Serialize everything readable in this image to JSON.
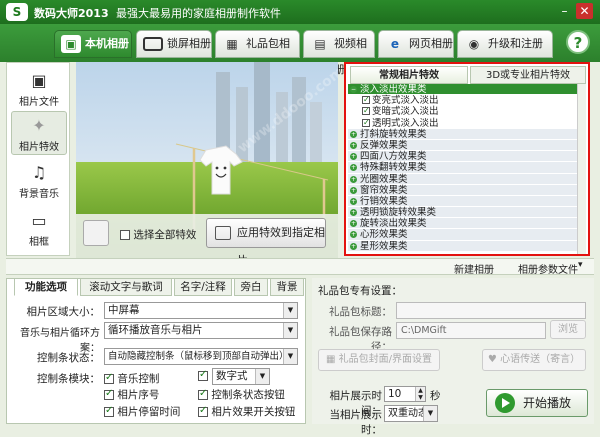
{
  "window": {
    "logo": "S",
    "app_name": "数码大师2013",
    "slogan": "最强大最易用的家庭相册制作软件"
  },
  "top_tabs": [
    {
      "label": "本机相册",
      "icon": "photo-album-icon"
    },
    {
      "label": "锁屏相册",
      "icon": "monitor-icon"
    },
    {
      "label": "礼品包相册",
      "icon": "gift-icon"
    },
    {
      "label": "视频相册",
      "icon": "film-icon"
    },
    {
      "label": "网页相册",
      "icon": "browser-icon"
    },
    {
      "label": "升级和注册",
      "icon": "upgrade-icon"
    }
  ],
  "help": {
    "label": "?"
  },
  "sidebar": {
    "items": [
      {
        "label": "相片文件",
        "icon": "camera-icon"
      },
      {
        "label": "相片特效",
        "icon": "sparkle-icon"
      },
      {
        "label": "背景音乐",
        "icon": "music-note-icon"
      },
      {
        "label": "相框",
        "icon": "frame-icon"
      }
    ]
  },
  "preview": {
    "select_all_label": "选择全部特效",
    "apply_label": "应用特效到指定相片"
  },
  "effects": {
    "tabs": [
      "常规相片特效",
      "3D或专业相片特效"
    ],
    "items": [
      {
        "label": "淡入淡出效果类",
        "type": "group",
        "selected": true
      },
      {
        "label": "变亮式淡入淡出",
        "type": "child",
        "checked": true
      },
      {
        "label": "变暗式淡入淡出",
        "type": "child",
        "checked": true
      },
      {
        "label": "透明式淡入淡出",
        "type": "child",
        "checked": true
      },
      {
        "label": "打斜旋转效果类",
        "type": "group"
      },
      {
        "label": "反弹效果类",
        "type": "group"
      },
      {
        "label": "四面八方效果类",
        "type": "group"
      },
      {
        "label": "特殊翻转效果类",
        "type": "group"
      },
      {
        "label": "光圈效果类",
        "type": "group"
      },
      {
        "label": "窗帘效果类",
        "type": "group"
      },
      {
        "label": "行销效果类",
        "type": "group"
      },
      {
        "label": "透明锁旋转效果类",
        "type": "group"
      },
      {
        "label": "旋转淡出效果类",
        "type": "group"
      },
      {
        "label": "心形效果类",
        "type": "group"
      },
      {
        "label": "星形效果类",
        "type": "group"
      }
    ]
  },
  "midbar": {
    "new_album": "新建相册",
    "album_params": "相册参数文件"
  },
  "bottom_tabs": [
    "功能选项",
    "滚动文字与歌词",
    "名字/注释",
    "旁白",
    "背景"
  ],
  "options": {
    "album_size_label": "相片区域大小：",
    "album_size_value": "中屏幕",
    "loop_label": "音乐与相片循环方案：",
    "loop_value": "循环播放音乐与相片",
    "control_label": "控制条状态：",
    "control_value": "自动隐藏控制条（鼠标移到顶部自动弹出）",
    "modules_label": "控制条模块：",
    "checks": [
      {
        "label": "音乐控制",
        "checked": true
      },
      {
        "label": "数字式",
        "checked": true,
        "combo": true
      },
      {
        "label": "相片序号",
        "checked": true
      },
      {
        "label": "控制条状态按钮",
        "checked": true
      },
      {
        "label": "相片停留时间",
        "checked": true
      },
      {
        "label": "相片效果开关按钮",
        "checked": true
      }
    ]
  },
  "gift": {
    "header": "礼品包专有设置：",
    "title_label": "礼品包标题：",
    "path_label": "礼品包保存路径：",
    "path_value": "C:\\DMGift",
    "browse_label": "浏览",
    "skin_label": "礼品包封面/界面设置",
    "blessing_label": "心语传送（寄言）",
    "time_label": "相片展示时间：",
    "time_value": "10",
    "time_unit": "秒",
    "mode_label": "当相片展示时：",
    "mode_value": "双重动态",
    "start_label": "开始播放"
  },
  "colors": {
    "brand": "#2d8a2d",
    "highlight": "#e3120f"
  }
}
